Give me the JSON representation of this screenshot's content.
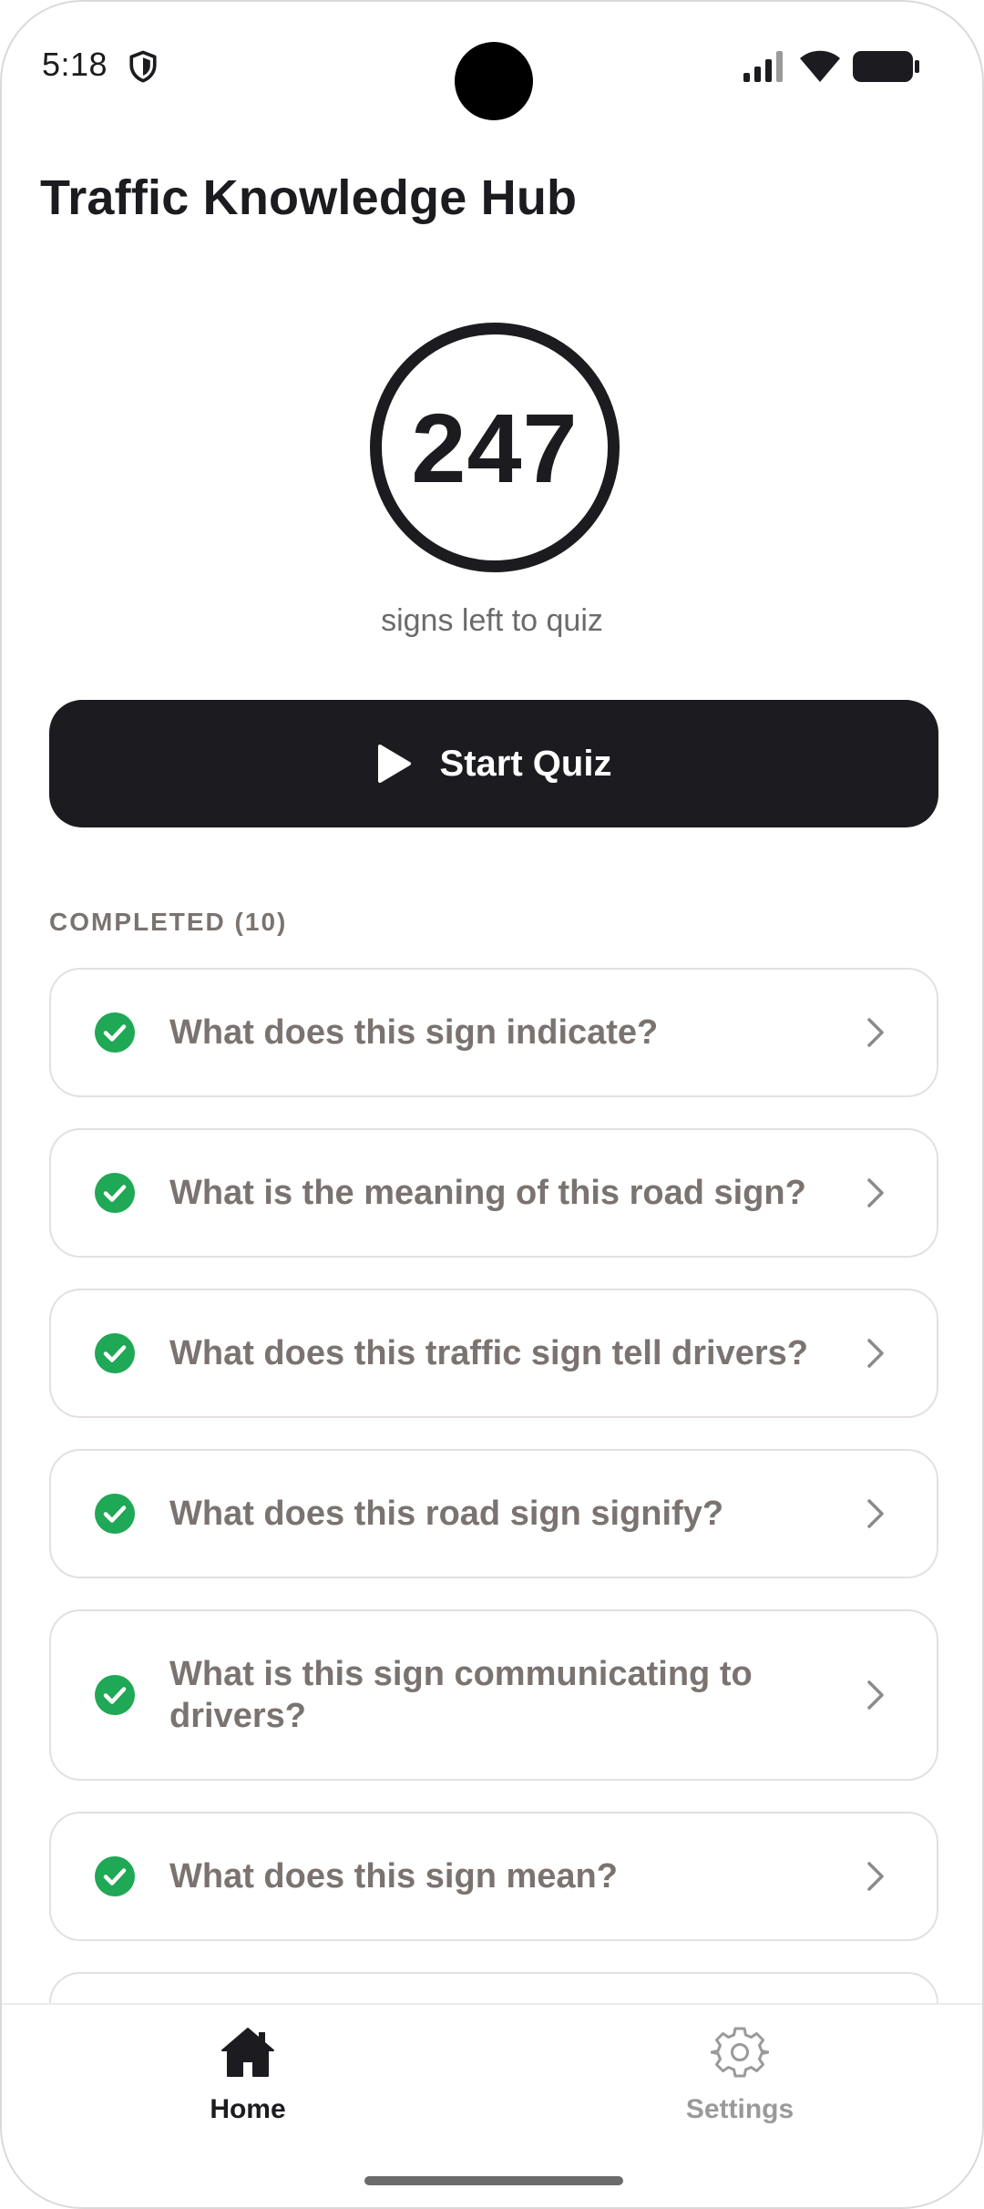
{
  "status_bar": {
    "time": "5:18",
    "icons": [
      "shield-icon",
      "signal-icon",
      "wifi-icon",
      "battery-icon"
    ]
  },
  "header": {
    "title": "Traffic Knowledge Hub"
  },
  "counter": {
    "value": "247",
    "caption": "signs left to quiz"
  },
  "start_button": {
    "label": "Start Quiz",
    "icon": "play-icon"
  },
  "completed": {
    "header": "COMPLETED (10)",
    "items": [
      {
        "text": "What does this sign indicate?"
      },
      {
        "text": "What is the meaning of this road sign?"
      },
      {
        "text": "What does this traffic sign tell drivers?"
      },
      {
        "text": "What does this road sign signify?"
      },
      {
        "text": "What is this sign communicating to drivers?"
      },
      {
        "text": "What does this sign mean?"
      }
    ]
  },
  "bottom_nav": {
    "items": [
      {
        "label": "Home",
        "icon": "home-icon",
        "active": true
      },
      {
        "label": "Settings",
        "icon": "gear-icon",
        "active": false
      }
    ]
  },
  "colors": {
    "primary": "#1c1b1f",
    "success": "#1fa855",
    "muted_text": "#7a7370",
    "card_border": "#e3e0df"
  }
}
